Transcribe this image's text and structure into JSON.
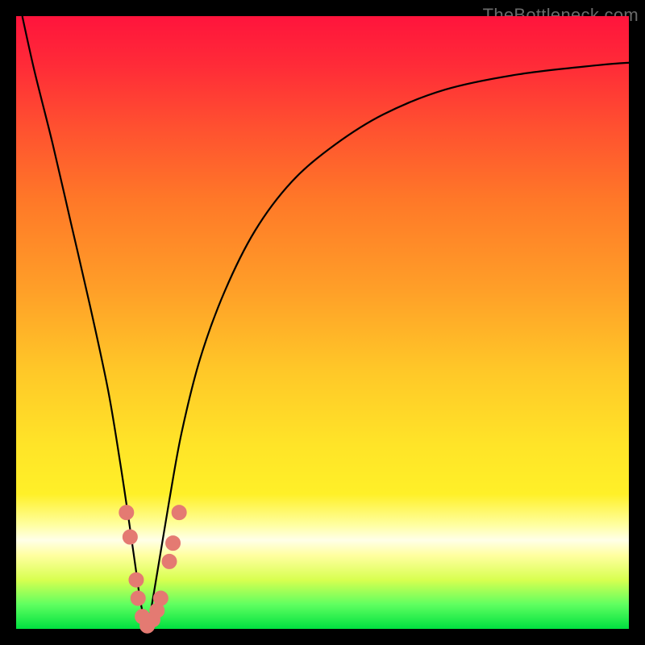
{
  "watermark": "TheBottleneck.com",
  "colors": {
    "frame": "#000000",
    "curve": "#000000",
    "marker": "#e47a72",
    "top": "#ff143c",
    "mid": "#ffe428",
    "band": "#ffffe8",
    "bottom": "#00e040"
  },
  "chart_data": {
    "type": "line",
    "title": "",
    "xlabel": "",
    "ylabel": "",
    "xlim": [
      0,
      100
    ],
    "ylim": [
      0,
      100
    ],
    "series": [
      {
        "name": "bottleneck-curve",
        "x": [
          1,
          3,
          6,
          9,
          12,
          15,
          17,
          18.5,
          19.5,
          20.2,
          20.8,
          21.3,
          21.8,
          22.5,
          23.5,
          25,
          27,
          30,
          34,
          39,
          45,
          52,
          60,
          70,
          82,
          95,
          100
        ],
        "y": [
          100,
          91,
          79,
          66,
          53,
          39,
          27,
          17,
          10,
          5,
          2,
          0,
          2,
          6,
          12,
          21,
          32,
          44,
          55,
          65,
          73,
          79,
          84,
          88,
          90.5,
          92,
          92.4
        ]
      }
    ],
    "markers": {
      "name": "sample-points",
      "note": "approximate positions read from image; values are percentages of plot area",
      "points": [
        {
          "x": 18.0,
          "y": 19
        },
        {
          "x": 18.6,
          "y": 15
        },
        {
          "x": 19.6,
          "y": 8
        },
        {
          "x": 19.9,
          "y": 5
        },
        {
          "x": 20.6,
          "y": 2
        },
        {
          "x": 21.4,
          "y": 0.5
        },
        {
          "x": 22.3,
          "y": 1.5
        },
        {
          "x": 23.0,
          "y": 3
        },
        {
          "x": 23.6,
          "y": 5
        },
        {
          "x": 25.0,
          "y": 11
        },
        {
          "x": 25.6,
          "y": 14
        },
        {
          "x": 26.6,
          "y": 19
        }
      ]
    }
  }
}
